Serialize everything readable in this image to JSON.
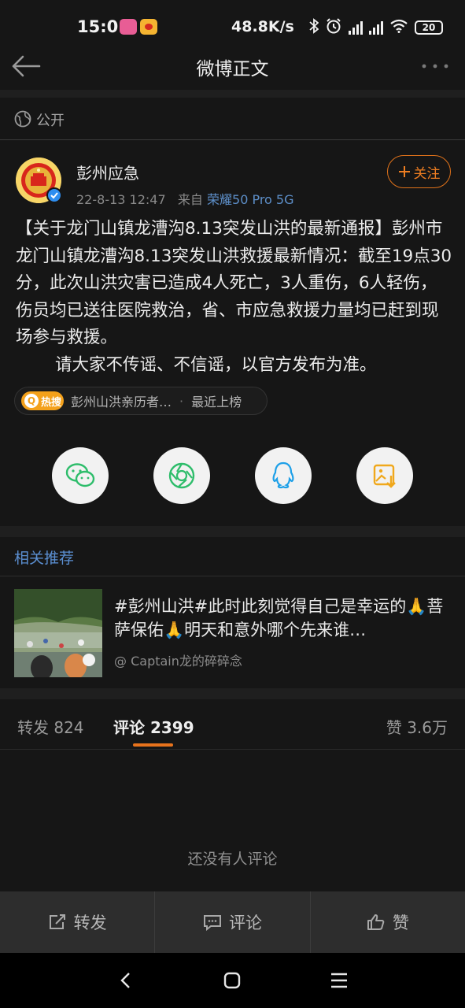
{
  "status_bar": {
    "time": "15:01",
    "network_speed": "48.8K/s",
    "battery": "20",
    "icons": [
      "pinduoduo-app-icon",
      "weibo-app-icon",
      "bluetooth-icon",
      "alarm-icon",
      "signal-icon",
      "signal-icon",
      "wifi-icon",
      "battery-icon"
    ]
  },
  "nav": {
    "title": "微博正文",
    "back_icon": "arrow-left-icon",
    "more_icon": "more-dots-icon"
  },
  "visibility": {
    "label": "公开",
    "icon": "globe-icon"
  },
  "post": {
    "author": "彭州应急",
    "date": "22-8-13 12:47",
    "source_prefix": "来自",
    "device": "荣耀50 Pro 5G",
    "follow_label": "关注",
    "paragraphs": [
      "【关于龙门山镇龙漕沟8.13突发山洪的最新通报】彭州市龙门山镇龙漕沟8.13突发山洪救援最新情况：截至19点30分，此次山洪灾害已造成4人死亡，3人重伤，6人轻伤，伤员均已送往医院救治，省、市应急救援力量均已赶到现场参与救援。",
      "请大家不传谣、不信谣，以官方发布为准。"
    ],
    "hot_tag": {
      "badge": "热搜",
      "text": "彭州山洪亲历者…",
      "separator": "·",
      "status": "最近上榜"
    }
  },
  "share": [
    {
      "name": "wechat",
      "icon": "wechat-icon",
      "color": "#2ebd6b"
    },
    {
      "name": "moments",
      "icon": "moments-icon",
      "color": "#2ebd6b"
    },
    {
      "name": "qq",
      "icon": "qq-icon",
      "color": "#1ea0e8"
    },
    {
      "name": "save-image",
      "icon": "save-image-icon",
      "color": "#f0a81c"
    }
  ],
  "related": {
    "header": "相关推荐",
    "item": {
      "title": "#彭州山洪#此时此刻觉得自己是幸运的🙏菩萨保佑🙏明天和意外哪个先来谁…",
      "author": "@ Captain龙的碎碎念"
    }
  },
  "stats": {
    "repost_label": "转发",
    "repost_count": "824",
    "comment_label": "评论",
    "comment_count": "2399",
    "like_label": "赞",
    "like_count": "3.6万"
  },
  "empty_state": "还没有人评论",
  "action_bar": {
    "repost": "转发",
    "comment": "评论",
    "like": "赞"
  },
  "accent_colors": {
    "orange": "#e8731c",
    "link_blue": "#5b8fd1",
    "verified_blue": "#2e8ef0"
  }
}
